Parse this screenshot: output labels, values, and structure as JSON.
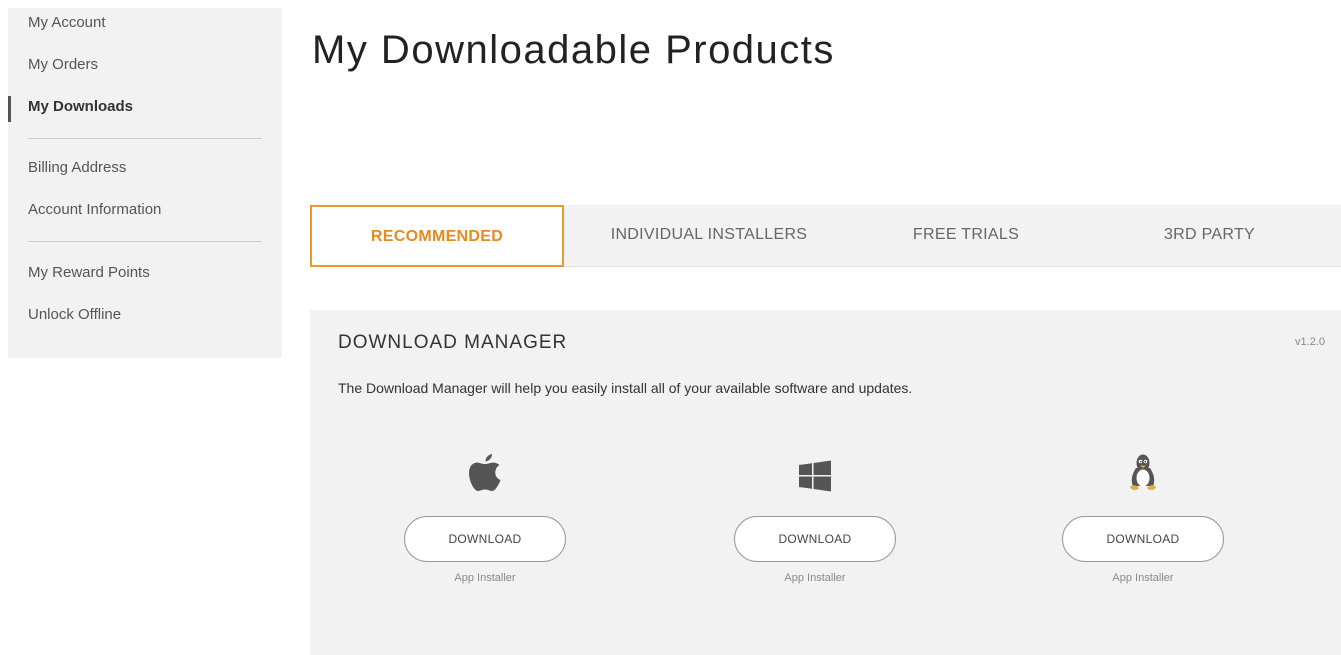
{
  "sidebar": {
    "group1": [
      "My Account",
      "My Orders",
      "My Downloads"
    ],
    "group2": [
      "Billing Address",
      "Account Information"
    ],
    "group3": [
      "My Reward Points",
      "Unlock Offline"
    ]
  },
  "page": {
    "title": "My Downloadable Products"
  },
  "tabs": [
    {
      "label": "RECOMMENDED"
    },
    {
      "label": "INDIVIDUAL INSTALLERS"
    },
    {
      "label": "FREE TRIALS"
    },
    {
      "label": "3RD PARTY"
    }
  ],
  "panel": {
    "title": "DOWNLOAD MANAGER",
    "version": "v1.2.0",
    "description": "The Download Manager will help you easily install all of your available software and updates.",
    "platforms": [
      {
        "icon": "apple-icon",
        "button": "DOWNLOAD",
        "caption": "App Installer"
      },
      {
        "icon": "windows-icon",
        "button": "DOWNLOAD",
        "caption": "App Installer"
      },
      {
        "icon": "linux-tux-icon",
        "button": "DOWNLOAD",
        "caption": "App Installer"
      }
    ]
  },
  "colors": {
    "accent": "#e68a1f",
    "panel_bg": "#f2f2f2",
    "icon": "#555555"
  }
}
